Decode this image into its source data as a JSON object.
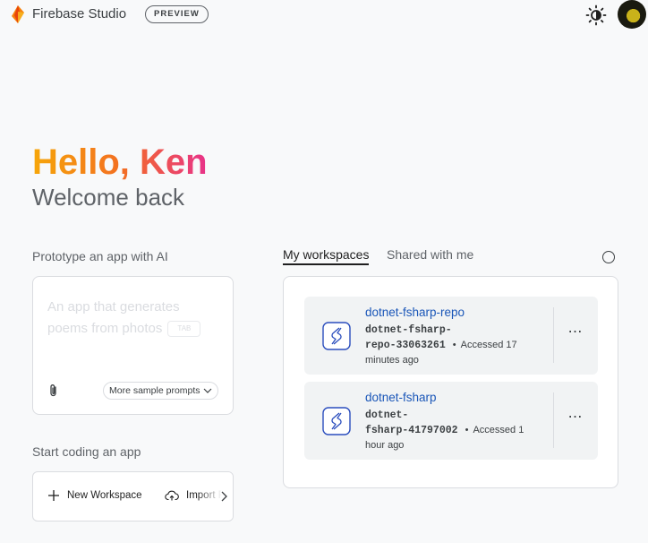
{
  "header": {
    "brand": "Firebase Studio",
    "badge": "PREVIEW",
    "theme_icon": "sun-icon",
    "avatar_icon": "user-avatar"
  },
  "greeting": {
    "hello": "Hello, Ken",
    "welcome": "Welcome back"
  },
  "prototype": {
    "label": "Prototype an app with AI",
    "placeholder": "An app that generates poems from photos",
    "tab_hint": "TAB",
    "attach_icon": "paperclip-icon",
    "sample_prompts": "More sample prompts"
  },
  "coding": {
    "label": "Start coding an app",
    "new_workspace": "New Workspace",
    "import_repo": "Import Repo"
  },
  "workspaces": {
    "tabs": [
      "My workspaces",
      "Shared with me"
    ],
    "active_tab": "My workspaces",
    "items": [
      {
        "name": "dotnet-fsharp-repo",
        "id_line1": "dotnet-fsharp-",
        "id_line2": "repo-33063261",
        "accessed_a": "Accessed 17",
        "accessed_b": "minutes ago"
      },
      {
        "name": "dotnet-fsharp",
        "id_line1": "dotnet-",
        "id_line2": "fsharp-41797002",
        "accessed_a": "Accessed 1",
        "accessed_b": "hour ago"
      }
    ],
    "separator": "•",
    "more": "⋯"
  },
  "colors": {
    "accent": "#1a56b8",
    "gradient_start": "#f6a609",
    "gradient_end": "#e8328a",
    "background": "#f8f9fa"
  }
}
